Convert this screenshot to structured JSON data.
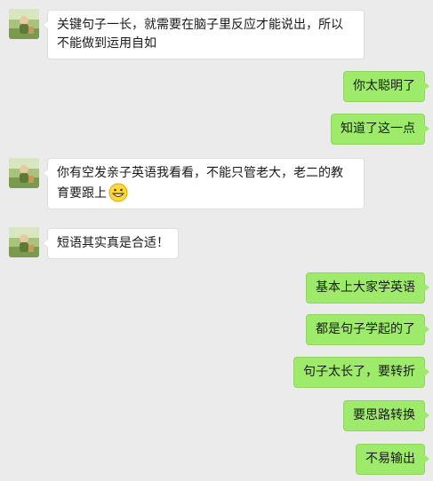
{
  "colors": {
    "background": "#ebebeb",
    "incoming_bubble": "#ffffff",
    "outgoing_bubble": "#9eea6a"
  },
  "messages": [
    {
      "side": "left",
      "text": "关键句子一长，就需要在脑子里反应才能说出，所以不能做到运用自如"
    },
    {
      "side": "right",
      "text": "你太聪明了"
    },
    {
      "side": "right",
      "text": "知道了这一点"
    },
    {
      "side": "left",
      "text": "你有空发亲子英语我看看，不能只管老大，老二的教育要跟上",
      "emoji": "grinning-face-icon"
    },
    {
      "side": "left",
      "text": "短语其实真是合适！"
    },
    {
      "side": "right",
      "text": "基本上大家学英语"
    },
    {
      "side": "right",
      "text": "都是句子学起的了"
    },
    {
      "side": "right",
      "text": "句子太长了，要转折"
    },
    {
      "side": "right",
      "text": "要思路转换"
    },
    {
      "side": "right",
      "text": "不易输出"
    }
  ]
}
